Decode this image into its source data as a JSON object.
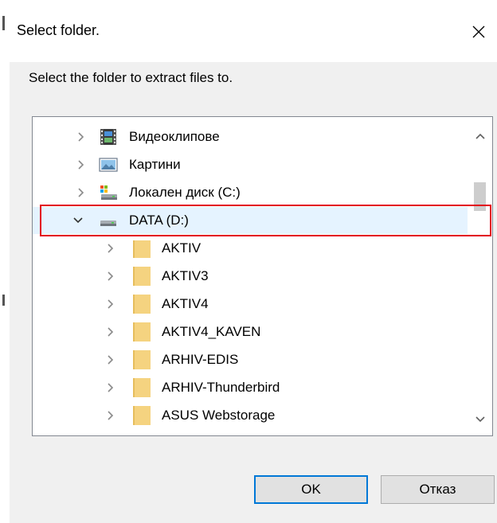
{
  "dialog": {
    "title": "Select folder.",
    "instruction": "Select the folder to extract files to."
  },
  "tree": {
    "items": [
      {
        "label": "Видеоклипове",
        "icon": "video-folder-icon",
        "expanded": false,
        "selected": false
      },
      {
        "label": "Картини",
        "icon": "pictures-folder-icon",
        "expanded": false,
        "selected": false
      },
      {
        "label": "Локален диск (C:)",
        "icon": "system-drive-icon",
        "expanded": false,
        "selected": false
      },
      {
        "label": "DATA (D:)",
        "icon": "drive-icon",
        "expanded": true,
        "selected": true
      },
      {
        "label": "AKTIV",
        "icon": "folder-icon",
        "expanded": false,
        "selected": false
      },
      {
        "label": "AKTIV3",
        "icon": "folder-icon",
        "expanded": false,
        "selected": false
      },
      {
        "label": "AKTIV4",
        "icon": "folder-icon",
        "expanded": false,
        "selected": false
      },
      {
        "label": "AKTIV4_KAVEN",
        "icon": "folder-icon",
        "expanded": false,
        "selected": false
      },
      {
        "label": "ARHIV-EDIS",
        "icon": "folder-icon",
        "expanded": false,
        "selected": false
      },
      {
        "label": "ARHIV-Thunderbird",
        "icon": "folder-icon",
        "expanded": false,
        "selected": false
      },
      {
        "label": "ASUS Webstorage",
        "icon": "folder-icon",
        "expanded": false,
        "selected": false
      }
    ]
  },
  "buttons": {
    "ok_label": "OK",
    "cancel_label": "Отказ"
  },
  "colors": {
    "highlight_border": "#e2001a",
    "selection": "#e5f3ff",
    "default_button_border": "#0078d7",
    "folder": "#f5d380"
  }
}
